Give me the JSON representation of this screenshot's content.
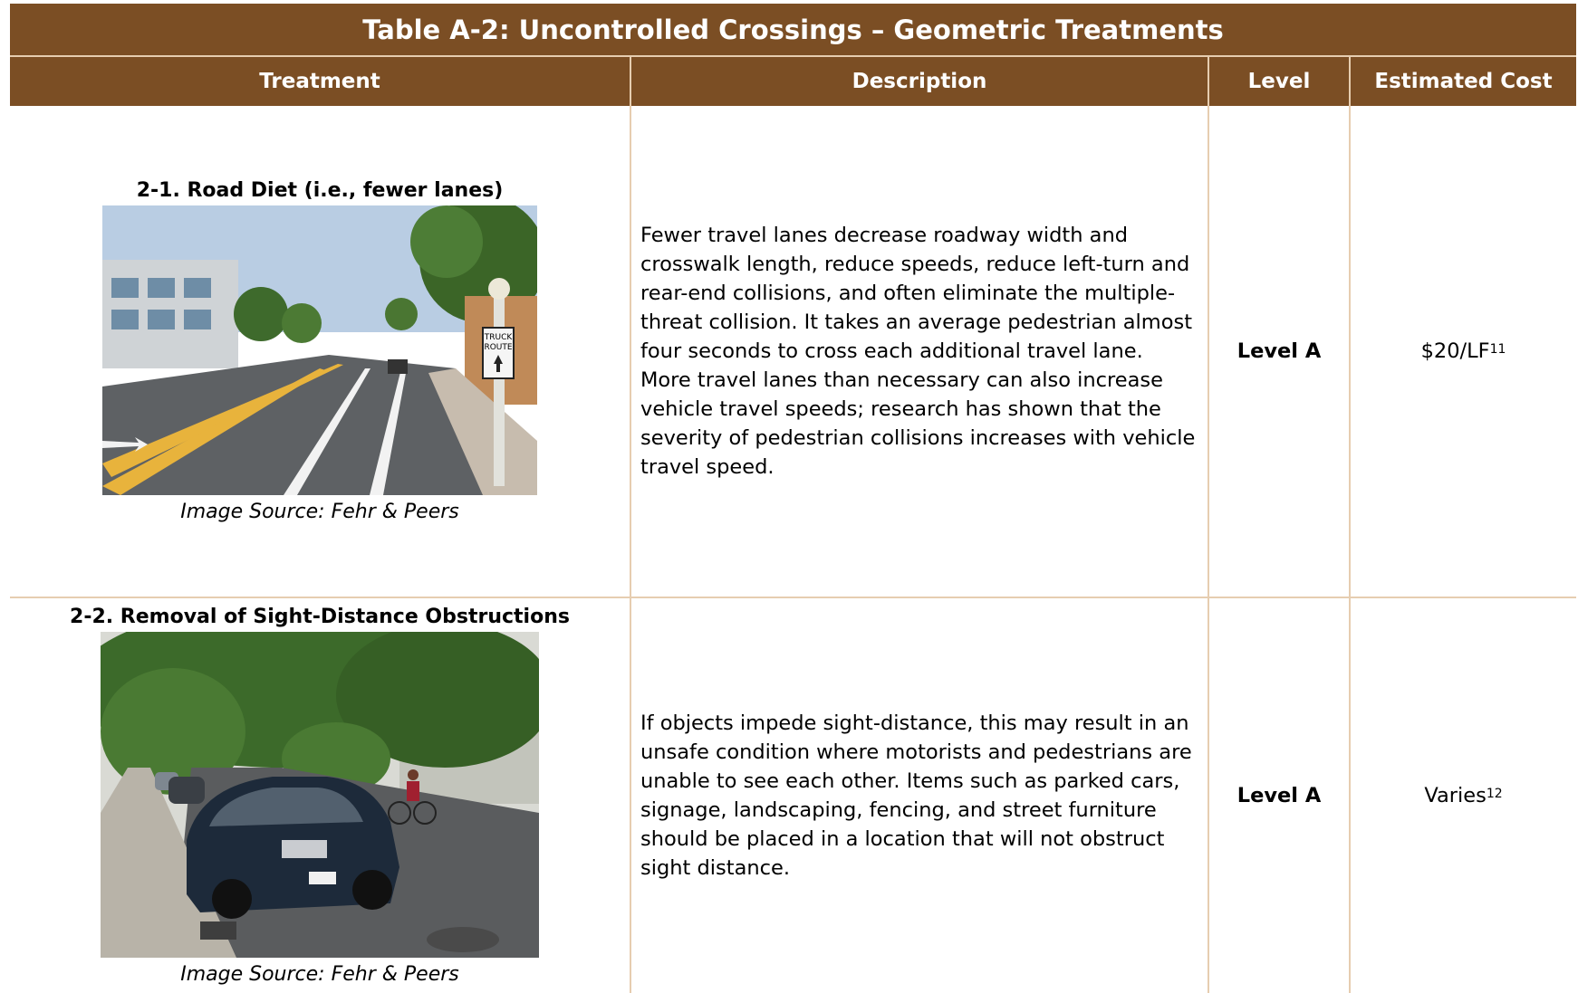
{
  "table": {
    "title": "Table A-2: Uncontrolled Crossings – Geometric Treatments",
    "headers": [
      "Treatment",
      "Description",
      "Level",
      "Estimated Cost"
    ],
    "rows": [
      {
        "treatment": "2-1. Road Diet (i.e., fewer lanes)",
        "image_caption": "Image Source: Fehr & Peers",
        "image_subject": "photo-road-diet-street",
        "sign_line1": "TRUCK",
        "sign_line2": "ROUTE",
        "description": "Fewer travel lanes decrease roadway width and crosswalk length, reduce speeds, reduce left-turn and rear-end collisions, and often eliminate the multiple-threat collision. It takes an average pedestrian almost four seconds to cross each additional travel lane. More travel lanes than necessary can also increase vehicle travel speeds; research has shown that the severity of pedestrian collisions increases with vehicle travel speed.",
        "level": "Level A",
        "cost": "$20/LF",
        "cost_note": "11"
      },
      {
        "treatment": "2-2. Removal of Sight-Distance Obstructions",
        "image_caption": "Image Source: Fehr & Peers",
        "image_subject": "photo-parked-cars-tree-lined-street",
        "description": "If objects impede sight-distance, this may result in an unsafe condition where motorists and pedestrians are unable to see each other. Items such as parked cars, signage, landscaping, fencing, and street furniture should be placed in a location that will not obstruct sight distance.",
        "level": "Level A",
        "cost": "Varies",
        "cost_note": "12"
      }
    ]
  },
  "colors": {
    "header_brown": "#7b4e24",
    "rule_tan": "#e6cdb0"
  }
}
